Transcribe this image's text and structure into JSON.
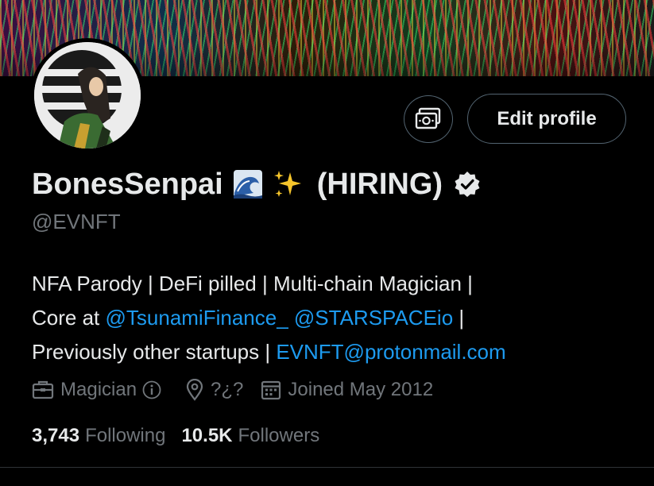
{
  "profile": {
    "name": "BonesSenpai",
    "name_emojis": [
      "wave-emoji",
      "sparkles-emoji"
    ],
    "hiring": "(HIRING)",
    "verified": true,
    "handle": "@EVNFT",
    "bio": {
      "line1": "NFA Parody | DeFi pilled | Multi-chain Magician |",
      "line2_prefix": "Core at ",
      "mention1": "@TsunamiFinance_",
      "mention2": "@STARSPACEio",
      "line2_suffix": " |",
      "line3_prefix": "Previously other startups | ",
      "email": "EVNFT@protonmail.com"
    },
    "meta": {
      "profession": "Magician",
      "location": "?¿?",
      "joined": "Joined May 2012"
    },
    "stats": {
      "following_count": "3,743",
      "following_label": "Following",
      "followers_count": "10.5K",
      "followers_label": "Followers"
    }
  },
  "actions": {
    "edit_profile": "Edit profile",
    "media_icon": "money-icon"
  },
  "colors": {
    "background": "#000000",
    "text": "#e7e9ea",
    "muted": "#71767b",
    "link": "#1d9bf0",
    "border": "#536471"
  }
}
